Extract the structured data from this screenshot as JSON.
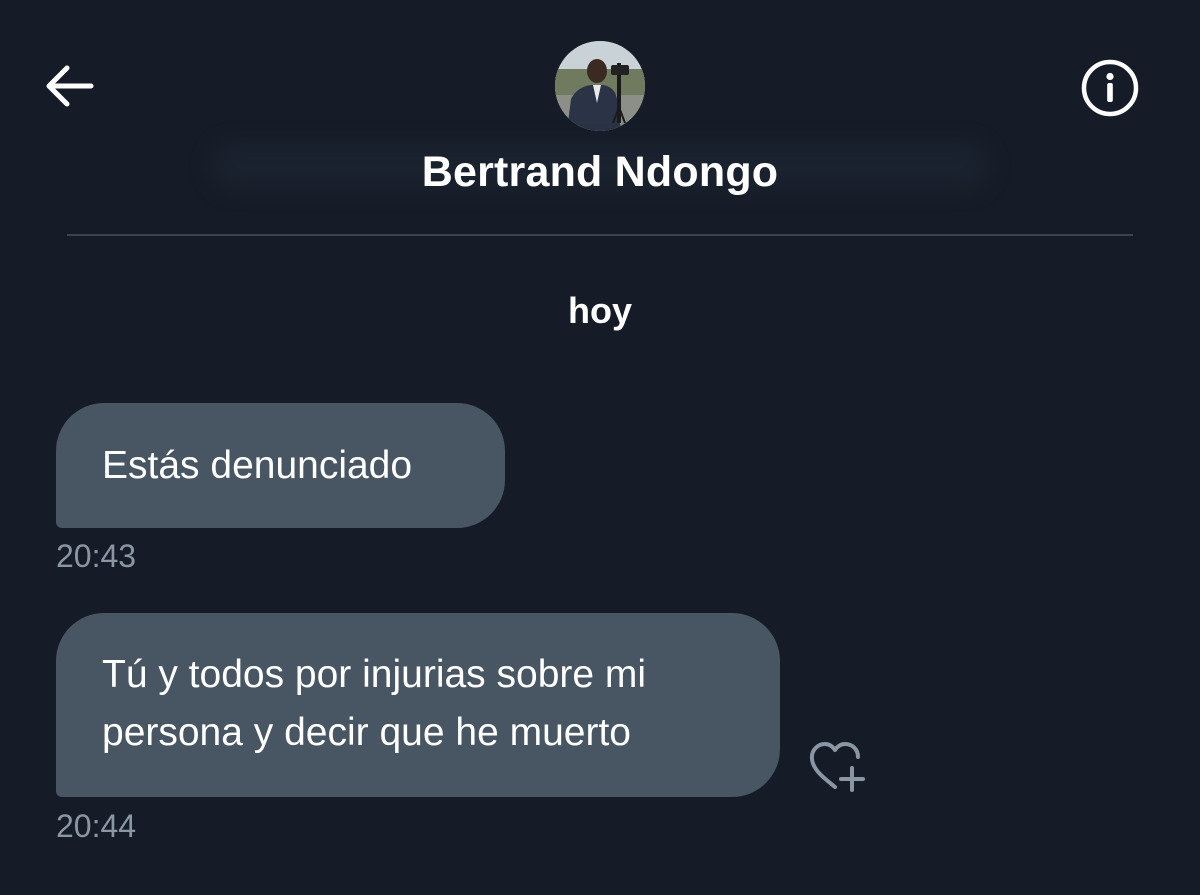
{
  "header": {
    "back_icon": "arrow-left-icon",
    "info_icon": "info-circle-icon",
    "contact_name": "Bertrand Ndongo"
  },
  "conversation": {
    "date_separator": "hoy",
    "messages": [
      {
        "text": "Estás denunciado",
        "time": "20:43"
      },
      {
        "text": "Tú y todos por injurias sobre mi persona y decir que he muerto",
        "time": "20:44",
        "reaction_icon": "heart-plus-icon"
      }
    ]
  },
  "colors": {
    "background": "#151c27",
    "bubble": "#485563",
    "timestamp": "#8a96a3",
    "divider": "#3b4452"
  }
}
